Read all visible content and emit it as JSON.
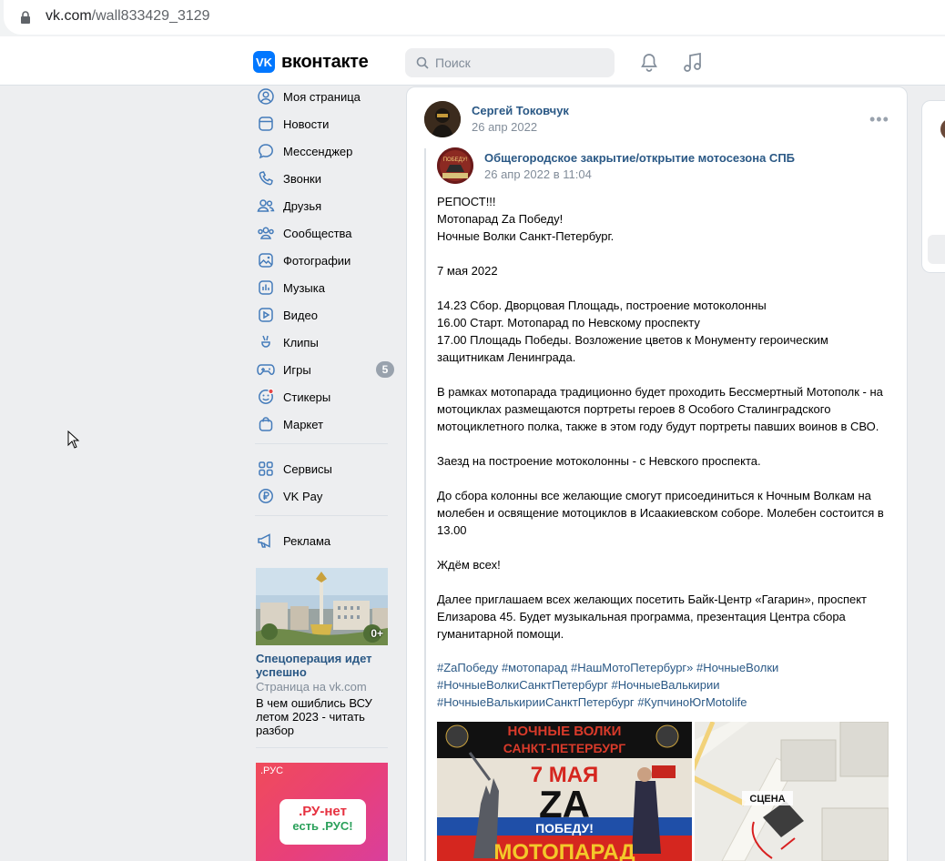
{
  "browser": {
    "url_domain": "vk.com",
    "url_path": "/wall833429_3129"
  },
  "header": {
    "logo_text": "вконтакте",
    "search_placeholder": "Поиск"
  },
  "sidebar": {
    "items": [
      {
        "label": "Моя страница",
        "icon": "user-icon"
      },
      {
        "label": "Новости",
        "icon": "news-icon"
      },
      {
        "label": "Мессенджер",
        "icon": "message-icon"
      },
      {
        "label": "Звонки",
        "icon": "phone-icon"
      },
      {
        "label": "Друзья",
        "icon": "friends-icon"
      },
      {
        "label": "Сообщества",
        "icon": "communities-icon"
      },
      {
        "label": "Фотографии",
        "icon": "photo-icon"
      },
      {
        "label": "Музыка",
        "icon": "music-icon"
      },
      {
        "label": "Видео",
        "icon": "video-icon"
      },
      {
        "label": "Клипы",
        "icon": "clips-icon"
      },
      {
        "label": "Игры",
        "icon": "games-icon",
        "badge": "5"
      },
      {
        "label": "Стикеры",
        "icon": "stickers-icon"
      },
      {
        "label": "Маркет",
        "icon": "market-icon"
      },
      {
        "label": "Сервисы",
        "icon": "services-icon"
      },
      {
        "label": "VK Pay",
        "icon": "vkpay-icon"
      },
      {
        "label": "Реклама",
        "icon": "ads-icon"
      }
    ],
    "ad": {
      "title": "Спецоперация идет успешно",
      "domain": "Страница на vk.com",
      "description": "В чем ошиблись ВСУ летом 2023 - читать разбор",
      "age": "0+"
    },
    "ad2": {
      "corner": ".РУС",
      "line1": ".РУ-нет",
      "line2": "есть .РУС!"
    }
  },
  "post": {
    "author": "Сергей Токовчук",
    "date": "26 апр 2022",
    "repost": {
      "name": "Общегородское закрытие/открытие мотосезона СПБ",
      "date": "26 апр 2022 в 11:04"
    },
    "paragraphs": [
      "РЕПОСТ!!!\nМотопарад Za Победу!\nНочные Волки Санкт-Петербург.",
      "7 мая 2022",
      "14.23 Сбор. Дворцовая Площадь, построение мотоколонны\n16.00 Старт. Мотопарад по Невскому проспекту\n17.00 Площадь Победы. Возложение цветов к Монументу героическим защитникам Ленинграда.",
      "В рамках мотопарада традиционно будет проходить Бессмертный Мотополк - на мотоциклах размещаются портреты героев 8 Особого Сталинградского мотоциклетного полка, также в этом году будут портреты павших воинов в СВО.",
      "Заезд на построение мотоколонны - с Невского проспекта.",
      "До сбора колонны все желающие смогут присоединиться к Ночным Волкам на молебен и освящение мотоциклов в Исаакиевском соборе. Молебен состоится в 13.00",
      "Ждём всех!",
      "Далее приглашаем всех желающих посетить Байк-Центр «Гагарин», проспект Елизарова 45. Будет музыкальная программа, презентация Центра сбора гуманитарной помощи."
    ],
    "tags": [
      "#ZaПобеду",
      "#мотопарад",
      "#НашМотоПетербург»",
      "#НочныеВолки",
      "#НочныеВолкиСанктПетербург",
      "#НочныеВалькирии",
      "#НочныеВалькирииСанктПетербург",
      "#КупчиноЮгMotolife"
    ],
    "poster": {
      "top": "НОЧНЫЕ ВОЛКИ",
      "top2": "САНКТ-ПЕТЕРБУРГ",
      "date": "7 МАЯ",
      "za": "ZA",
      "pobedu": "ПОБЕДУ!",
      "bottom": "МОТОПАРАД"
    },
    "map_label": "СЦЕНА"
  },
  "colors": {
    "accent": "#0077ff",
    "link": "#2a5885",
    "muted": "#818c99",
    "bg": "#edeef0"
  }
}
